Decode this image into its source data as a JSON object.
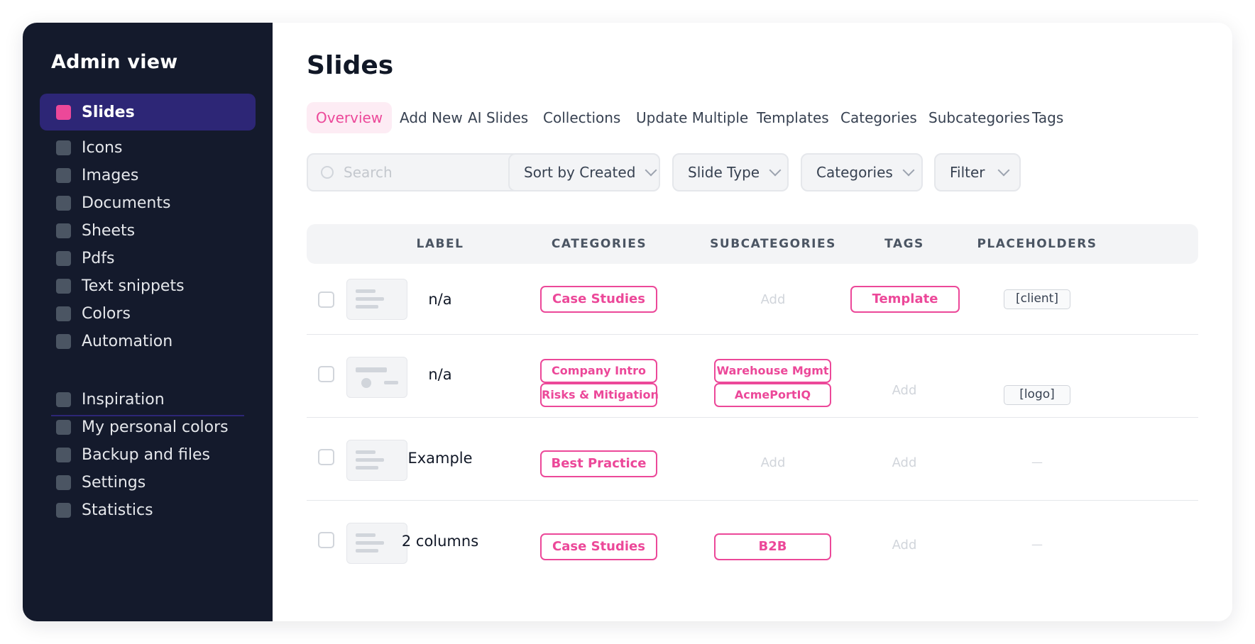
{
  "sidebar": {
    "title": "Admin view",
    "items": [
      {
        "label": "Slides",
        "active": true
      },
      {
        "label": "Icons"
      },
      {
        "label": "Images"
      },
      {
        "label": "Documents"
      },
      {
        "label": "Sheets"
      },
      {
        "label": "Pdfs"
      },
      {
        "label": "Text snippets"
      },
      {
        "label": "Colors"
      },
      {
        "label": "Automation"
      }
    ],
    "secondary_items": [
      {
        "label": "Inspiration"
      },
      {
        "label": "My personal colors"
      },
      {
        "label": "Backup and files"
      },
      {
        "label": "Settings"
      },
      {
        "label": "Statistics"
      }
    ]
  },
  "main": {
    "title": "Slides",
    "tabs": [
      {
        "label": "Overview",
        "active": true
      },
      {
        "label": "Add New"
      },
      {
        "label": "AI Slides"
      },
      {
        "label": "Collections"
      },
      {
        "label": "Update Multiple"
      },
      {
        "label": "Templates"
      },
      {
        "label": "Categories"
      },
      {
        "label": "Subcategories"
      },
      {
        "label": "Tags"
      }
    ],
    "search": {
      "placeholder": "Search",
      "value": ""
    },
    "filters": [
      {
        "label": "Sort by Created"
      },
      {
        "label": "Slide Type"
      },
      {
        "label": "Categories"
      },
      {
        "label": "Filter"
      }
    ]
  },
  "table": {
    "columns": [
      "LABEL",
      "CATEGORIES",
      "SUBCATEGORIES",
      "TAGS",
      "PLACEHOLDERS"
    ],
    "add_text": "Add",
    "empty_text": "—",
    "rows": [
      {
        "label": "n/a",
        "categories": [
          "Case Studies"
        ],
        "subcategories": [],
        "tags": [
          "Template"
        ],
        "placeholders": [
          "[client]"
        ]
      },
      {
        "label": "n/a",
        "categories": [
          "Company Intro",
          "Risks & Mitigation"
        ],
        "subcategories": [
          "Warehouse Mgmt",
          "AcmePortIQ"
        ],
        "tags": [],
        "placeholders": [
          "[logo]"
        ]
      },
      {
        "label": "Example",
        "categories": [
          "Best Practice"
        ],
        "subcategories": [],
        "tags": [],
        "placeholders": []
      },
      {
        "label": "2 columns",
        "categories": [
          "Case Studies"
        ],
        "subcategories": [
          "B2B"
        ],
        "tags": [],
        "placeholders": []
      }
    ]
  },
  "colors": {
    "sidebar_bg": "#141a2c",
    "active_item_bg": "#2d2676",
    "accent": "#ec4899"
  }
}
